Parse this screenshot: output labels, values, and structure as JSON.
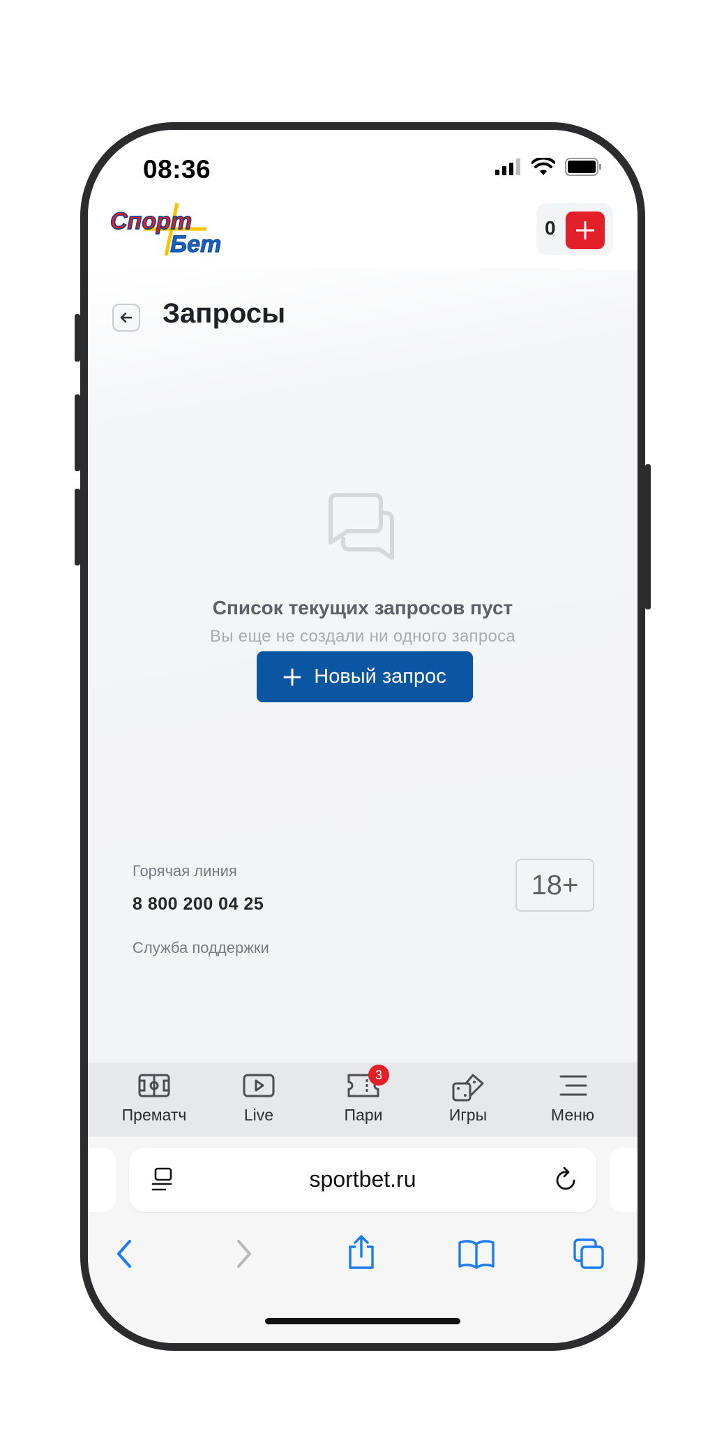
{
  "status_bar": {
    "time": "08:36"
  },
  "header": {
    "logo_text": "СпортБет",
    "balance": "0"
  },
  "page": {
    "title": "Запросы"
  },
  "empty_state": {
    "title": "Список текущих запросов пуст",
    "subtitle": "Вы еще не создали ни одного запроса",
    "button_label": "Новый запрос"
  },
  "footer": {
    "hotline_label": "Горячая линия",
    "hotline_phone": "8 800 200 04 25",
    "support_label": "Служба поддержки",
    "age_rating": "18+"
  },
  "tabbar": {
    "items": [
      {
        "label": "Прематч",
        "icon": "field-icon"
      },
      {
        "label": "Live",
        "icon": "play-icon"
      },
      {
        "label": "Пари",
        "icon": "ticket-icon",
        "badge": "3"
      },
      {
        "label": "Игры",
        "icon": "dice-icon"
      },
      {
        "label": "Меню",
        "icon": "menu-icon"
      }
    ]
  },
  "browser": {
    "url": "sportbet.ru"
  },
  "colors": {
    "accent": "#0b56a3",
    "brand_red": "#e3202a",
    "background": "#f3f4f6"
  }
}
